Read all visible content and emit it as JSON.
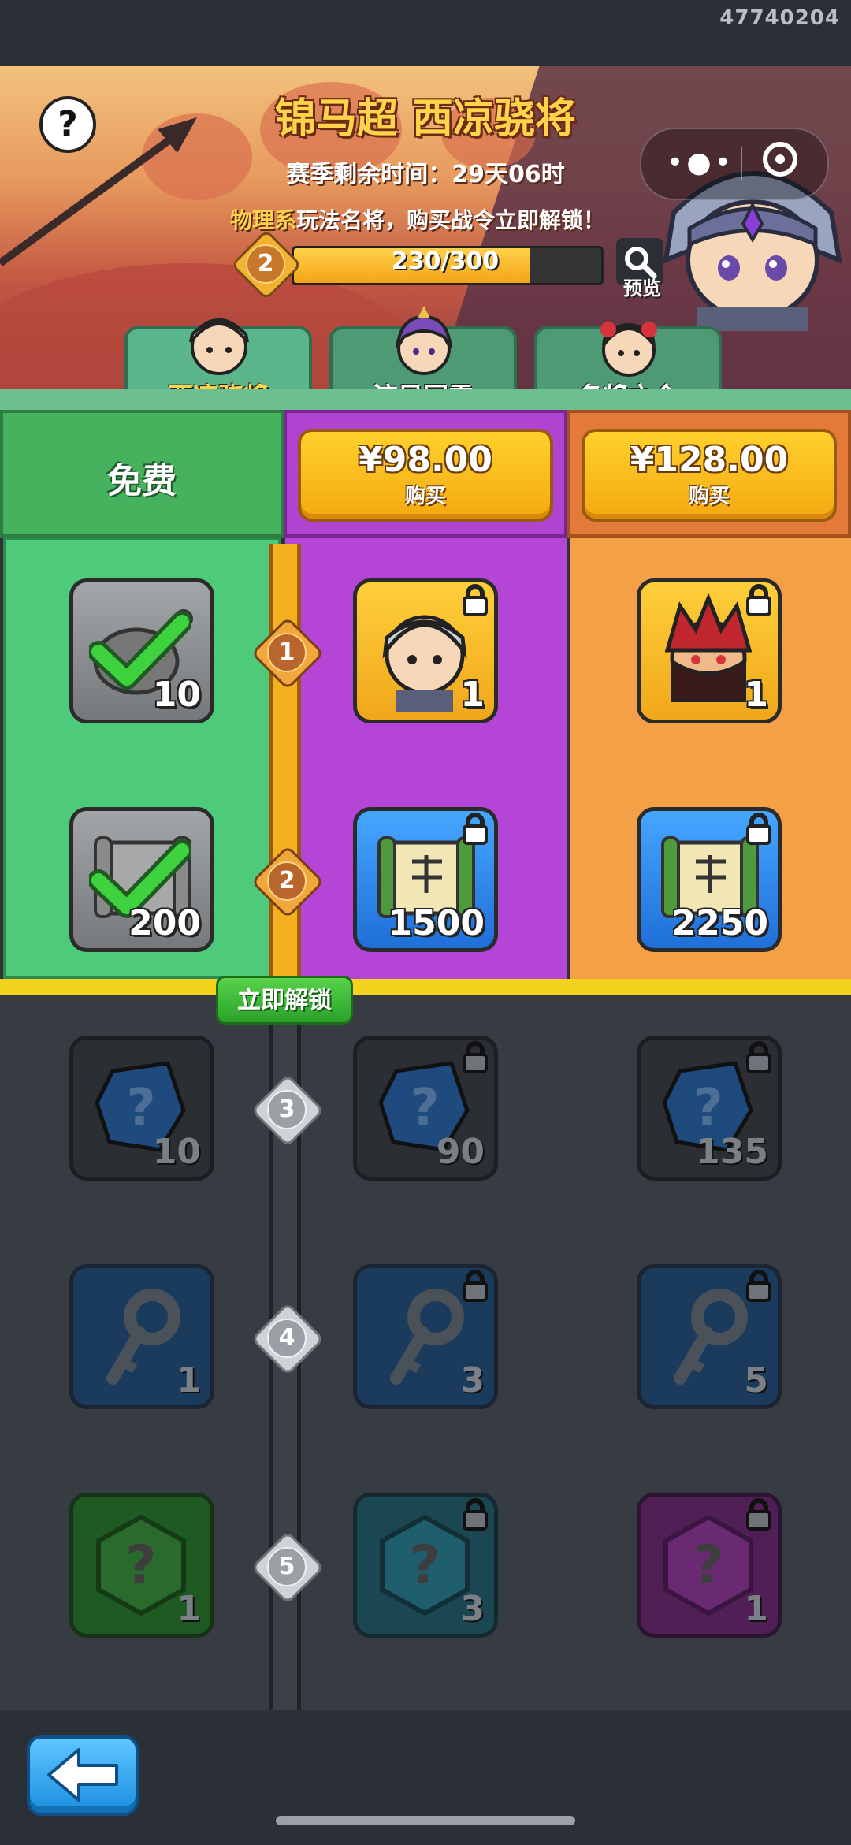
{
  "status": {
    "uid": "47740204"
  },
  "banner": {
    "title": "锦马超 西凉骁将",
    "season_text": "赛季剩余时间：29天06时",
    "promo_highlight": "物理系",
    "promo_rest": "玩法名将，购买战令立即解锁！",
    "level": "2",
    "progress_text": "230/300",
    "progress_fraction": 0.767,
    "preview_label": "预览"
  },
  "tabs": [
    {
      "label": "西凉骁将",
      "active": true
    },
    {
      "label": "流风回雪",
      "active": false
    },
    {
      "label": "名将之令",
      "active": false
    }
  ],
  "columns": {
    "free_label": "免费",
    "tier2_price": "¥98.00",
    "tier2_buy": "购买",
    "tier3_price": "¥128.00",
    "tier3_buy": "购买"
  },
  "unlock_button": "立即解锁",
  "levels": [
    {
      "n": "1",
      "free": {
        "item": "drumstick-icon",
        "qty": "10",
        "claimed": true
      },
      "tier2": {
        "item": "hero-portrait",
        "qty": "1",
        "locked": true
      },
      "tier3": {
        "item": "hero-portrait-red",
        "qty": "1",
        "locked": true
      }
    },
    {
      "n": "2",
      "free": {
        "item": "scroll-icon",
        "qty": "200",
        "claimed": true
      },
      "tier2": {
        "item": "scroll-icon",
        "qty": "1500",
        "locked": true
      },
      "tier3": {
        "item": "scroll-icon",
        "qty": "2250",
        "locked": true
      }
    },
    {
      "n": "3",
      "free": {
        "item": "mystery-gem-icon",
        "qty": "10"
      },
      "tier2": {
        "item": "mystery-gem-icon",
        "qty": "90",
        "locked": true
      },
      "tier3": {
        "item": "mystery-gem-icon",
        "qty": "135",
        "locked": true
      }
    },
    {
      "n": "4",
      "free": {
        "item": "key-icon",
        "qty": "1"
      },
      "tier2": {
        "item": "key-icon",
        "qty": "3",
        "locked": true
      },
      "tier3": {
        "item": "key-icon",
        "qty": "5",
        "locked": true
      }
    },
    {
      "n": "5",
      "free": {
        "item": "mystery-hex-icon",
        "qty": "1"
      },
      "tier2": {
        "item": "mystery-hex-icon",
        "qty": "3",
        "locked": true
      },
      "tier3": {
        "item": "mystery-hex-icon",
        "qty": "1",
        "locked": true
      }
    }
  ],
  "colors": {
    "accent": "#ffd34a",
    "free": "#4dca7a",
    "tier2": "#b445d6",
    "tier3": "#f4a046"
  }
}
